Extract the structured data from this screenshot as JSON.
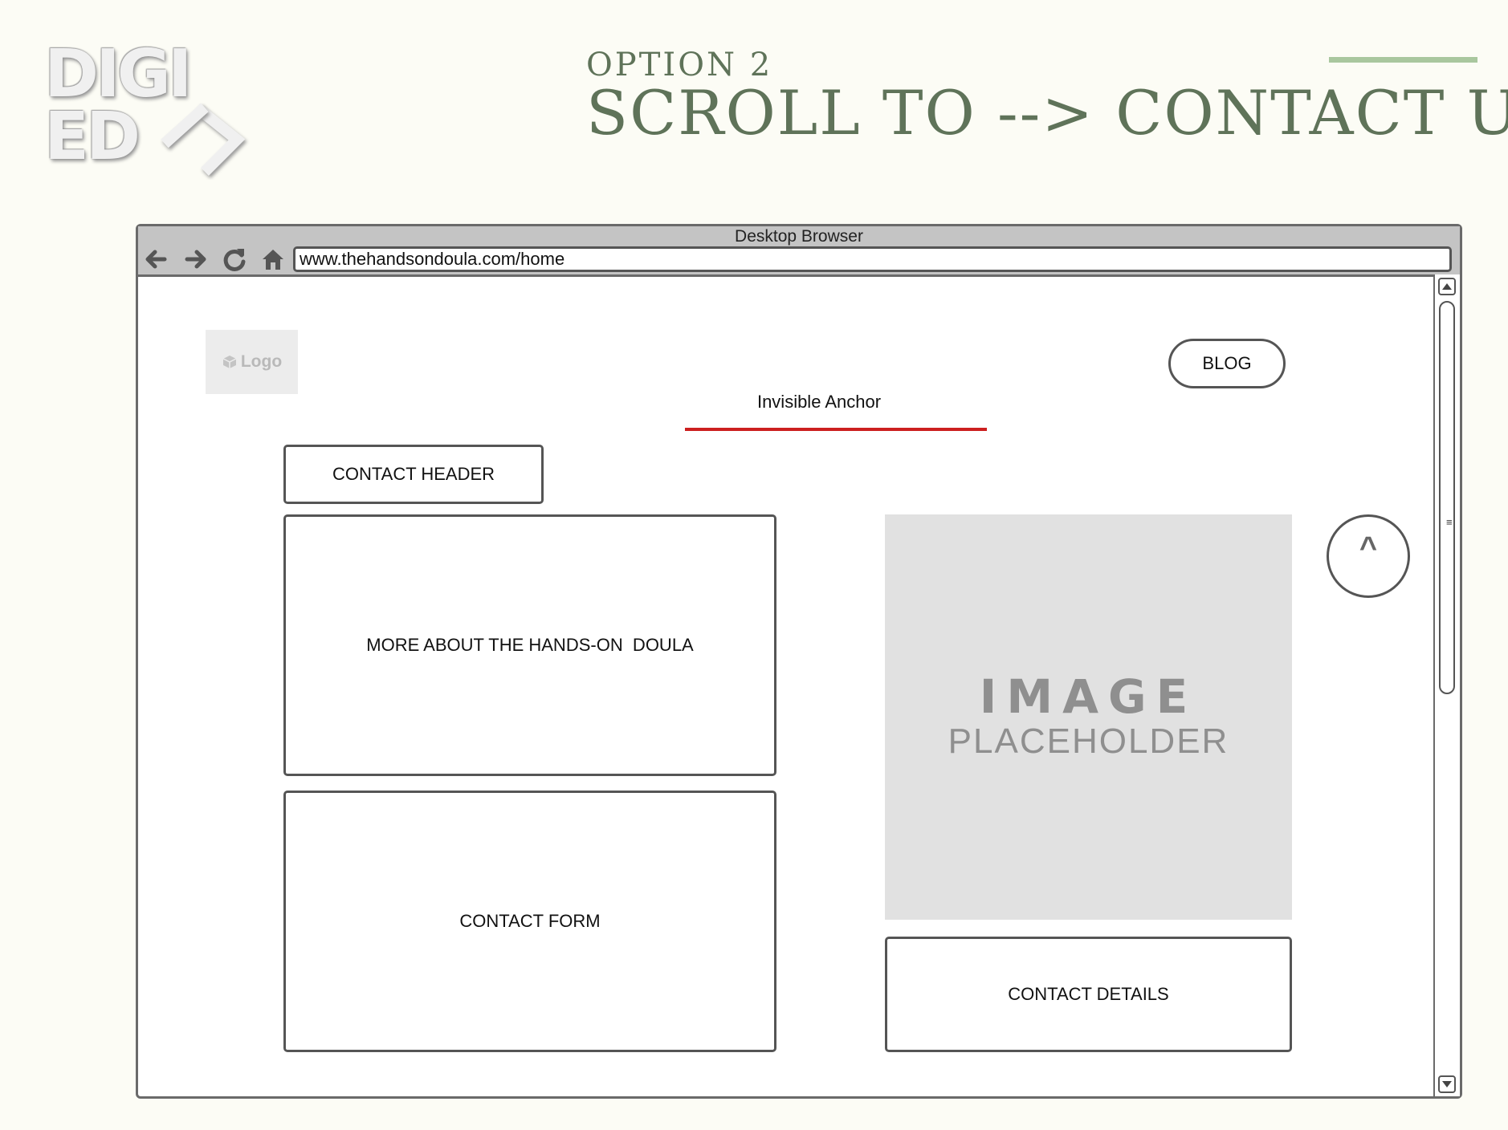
{
  "brand": {
    "line1": "DIGI",
    "line2": "ED"
  },
  "heading": {
    "subtitle": "OPTION 2",
    "title": "SCROLL TO --> CONTACT US",
    "text_color": "#5f7359",
    "accent_color": "#a9c79e"
  },
  "browser": {
    "window_title": "Desktop Browser",
    "url": "www.thehandsondoula.com/home",
    "nav_icons": [
      "back-arrow-icon",
      "forward-arrow-icon",
      "refresh-icon",
      "home-icon"
    ]
  },
  "page": {
    "logo_label": "Logo",
    "blog_label": "BLOG",
    "anchor_label": "Invisible Anchor",
    "anchor_color": "#cc1f1f",
    "contact_header": "CONTACT HEADER",
    "more_about": "MORE ABOUT THE HANDS-ON  DOULA",
    "contact_form": "CONTACT FORM",
    "image_placeholder": {
      "line1": "IMAGE",
      "line2": "PLACEHOLDER"
    },
    "contact_details": "CONTACT DETAILS",
    "back_to_top": "^"
  }
}
